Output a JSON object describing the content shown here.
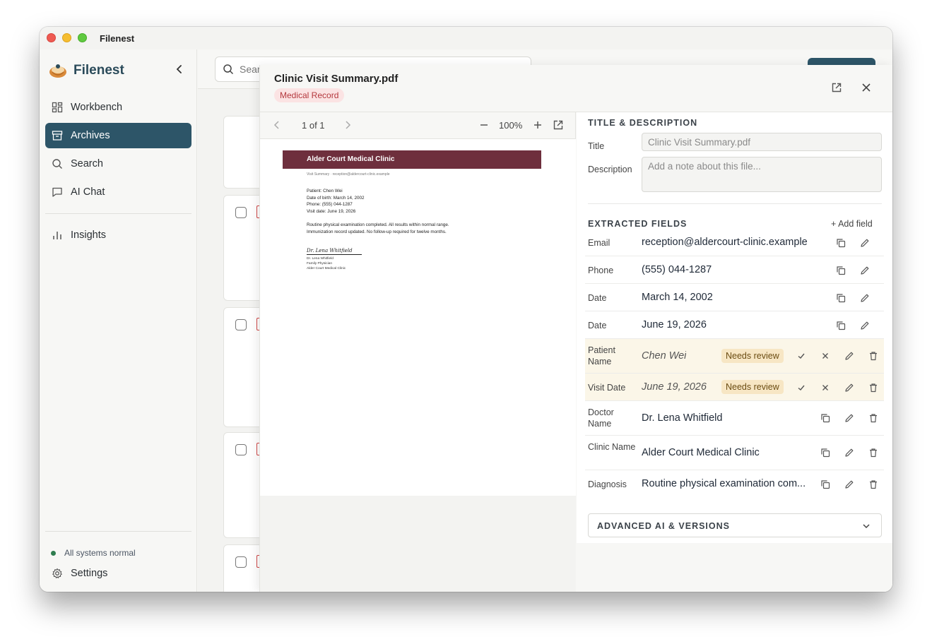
{
  "window": {
    "title": "Filenest"
  },
  "sidebar": {
    "brand": "Filenest",
    "items": [
      {
        "label": "Workbench",
        "icon": "grid-icon"
      },
      {
        "label": "Archives",
        "icon": "archive-icon",
        "active": true
      },
      {
        "label": "Search",
        "icon": "search-icon"
      },
      {
        "label": "AI Chat",
        "icon": "chat-icon"
      },
      {
        "label": "Insights",
        "icon": "bar-chart-icon"
      }
    ],
    "status": "All systems normal",
    "settings": "Settings"
  },
  "topbar": {
    "search_placeholder": "Sear"
  },
  "modal": {
    "title": "Clinic Visit Summary.pdf",
    "badge": "Medical Record",
    "viewer": {
      "page_indicator": "1 of 1",
      "zoom": "100%"
    },
    "document": {
      "header": "Alder Court Medical Clinic",
      "subheader": "Visit Summary · reception@aldercourt-clinic.example",
      "lines": [
        "Patient: Chen Wei",
        "Date of birth: March 14, 2002",
        "Phone: (555) 044-1287",
        "Visit date: June 19, 2026",
        "Routine physical examination completed. All results within normal range.",
        "Immunization record updated. No follow-up required for twelve months."
      ],
      "signature": "Dr. Lena Whitfield",
      "signature_block": [
        "Dr. Lena Whitfield",
        "Family Physician",
        "Alder Court Medical Clinic"
      ]
    },
    "details": {
      "section_title": "TITLE & DESCRIPTION",
      "title_label": "Title",
      "title_value": "Clinic Visit Summary.pdf",
      "description_label": "Description",
      "description_placeholder": "Add a note about this file...",
      "extracted_title": "EXTRACTED FIELDS",
      "add_field": "+ Add field",
      "fields": [
        {
          "label": "Email",
          "value": "reception@aldercourt-clinic.example"
        },
        {
          "label": "Phone",
          "value": "(555) 044-1287"
        },
        {
          "label": "Date",
          "value": "March 14, 2002"
        },
        {
          "label": "Date",
          "value": "June 19, 2026"
        },
        {
          "label": "Patient Name",
          "value": "Chen Wei",
          "status": "Needs review"
        },
        {
          "label": "Visit Date",
          "value": "June 19, 2026",
          "status": "Needs review"
        },
        {
          "label": "Doctor Name",
          "value": "Dr. Lena Whitfield"
        },
        {
          "label": "Clinic Name",
          "value": "Alder Court Medical Clinic"
        },
        {
          "label": "Diagnosis",
          "value": "Routine physical examination com..."
        }
      ],
      "advanced": "ADVANCED AI & VERSIONS"
    }
  }
}
